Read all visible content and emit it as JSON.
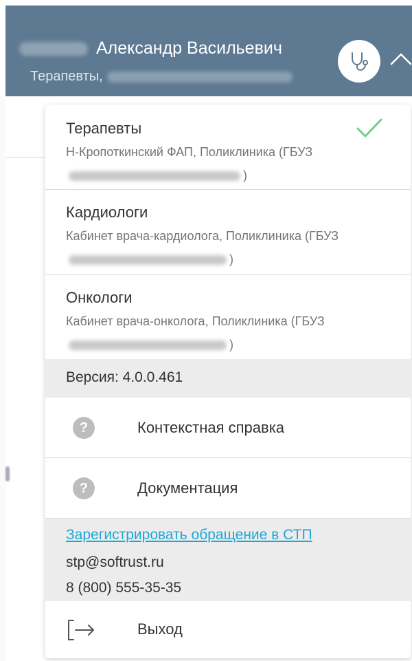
{
  "header": {
    "user_name": "Александр Васильевич",
    "user_role": "Терапевты,",
    "profile_icon": "stethoscope-icon",
    "toggle_icon": "chevron-up-icon"
  },
  "menu": {
    "roles": [
      {
        "title": "Терапевты",
        "desc_before": "Н-Кропоткинский ФАП, Поликлиника (ГБУЗ",
        "desc_after": ")",
        "selected": true
      },
      {
        "title": "Кардиологи",
        "desc_before": "Кабинет врача-кардиолога, Поликлиника (ГБУЗ",
        "desc_after": ")",
        "selected": false
      },
      {
        "title": "Онкологи",
        "desc_before": "Кабинет врача-онколога, Поликлиника (ГБУЗ",
        "desc_after": ")",
        "selected": false
      }
    ],
    "version": "Версия: 4.0.0.461",
    "items": [
      {
        "label": "Контекстная справка",
        "icon": "help-icon"
      },
      {
        "label": "Документация",
        "icon": "help-icon"
      }
    ],
    "support": {
      "link": "Зарегистрировать обращение в СТП",
      "email": "stp@softrust.ru",
      "phone": "8 (800) 555-35-35"
    },
    "logout": {
      "label": "Выход",
      "icon": "logout-icon"
    }
  },
  "colors": {
    "header_bg": "#5e7a92",
    "link": "#1ea7d6",
    "check": "#6fcf8a",
    "gray_band": "#ececec"
  }
}
